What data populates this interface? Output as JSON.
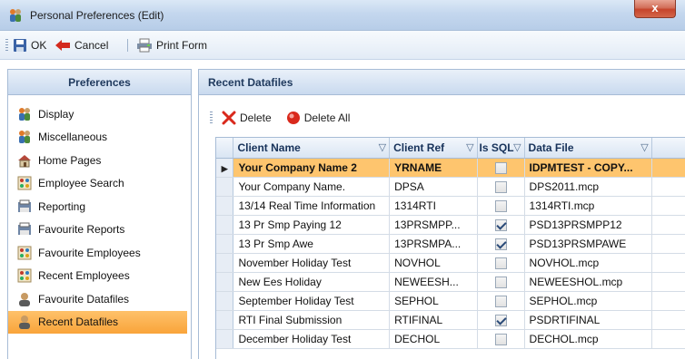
{
  "window": {
    "title": "Personal Preferences (Edit)",
    "close_label": "x"
  },
  "toolbar": {
    "ok_label": "OK",
    "cancel_label": "Cancel",
    "print_label": "Print Form"
  },
  "preferences": {
    "header": "Preferences",
    "items": [
      {
        "label": "Display",
        "icon": "people-icon"
      },
      {
        "label": "Miscellaneous",
        "icon": "people-icon"
      },
      {
        "label": "Home Pages",
        "icon": "home-icon"
      },
      {
        "label": "Employee Search",
        "icon": "group-icon"
      },
      {
        "label": "Reporting",
        "icon": "report-icon"
      },
      {
        "label": "Favourite Reports",
        "icon": "report-icon"
      },
      {
        "label": "Favourite Employees",
        "icon": "group-icon"
      },
      {
        "label": "Recent Employees",
        "icon": "group-icon"
      },
      {
        "label": "Favourite Datafiles",
        "icon": "person-icon"
      },
      {
        "label": "Recent Datafiles",
        "icon": "person-icon",
        "selected": true
      }
    ]
  },
  "recent": {
    "header": "Recent Datafiles",
    "delete_label": "Delete",
    "delete_all_label": "Delete All",
    "columns": [
      "Client Name",
      "Client Ref",
      "Is SQL",
      "Data File"
    ],
    "rows": [
      {
        "name": "Your Company Name 2",
        "ref": "YRNAME",
        "sql": false,
        "file": "IDPMTEST - COPY...",
        "current": true
      },
      {
        "name": "Your Company Name.",
        "ref": "DPSA",
        "sql": false,
        "file": "DPS2011.mcp"
      },
      {
        "name": "13/14 Real Time Information",
        "ref": "1314RTI",
        "sql": false,
        "file": "1314RTI.mcp"
      },
      {
        "name": "13 Pr Smp Paying 12",
        "ref": "13PRSMPP...",
        "sql": true,
        "file": "PSD13PRSMPP12"
      },
      {
        "name": "13 Pr Smp Awe",
        "ref": "13PRSMPA...",
        "sql": true,
        "file": "PSD13PRSMPAWE"
      },
      {
        "name": "November Holiday Test",
        "ref": "NOVHOL",
        "sql": false,
        "file": "NOVHOL.mcp"
      },
      {
        "name": "New Ees Holiday",
        "ref": "NEWEESH...",
        "sql": false,
        "file": "NEWEESHOL.mcp"
      },
      {
        "name": "September Holiday Test",
        "ref": "SEPHOL",
        "sql": false,
        "file": "SEPHOL.mcp"
      },
      {
        "name": "RTI Final Submission",
        "ref": "RTIFINAL",
        "sql": true,
        "file": "PSDRTIFINAL"
      },
      {
        "name": "December Holiday Test",
        "ref": "DECHOL",
        "sql": false,
        "file": "DECHOL.mcp"
      }
    ]
  },
  "colors": {
    "selection": "#fdb04a",
    "header_text": "#203a5e",
    "delete_icon": "#d9291c"
  }
}
